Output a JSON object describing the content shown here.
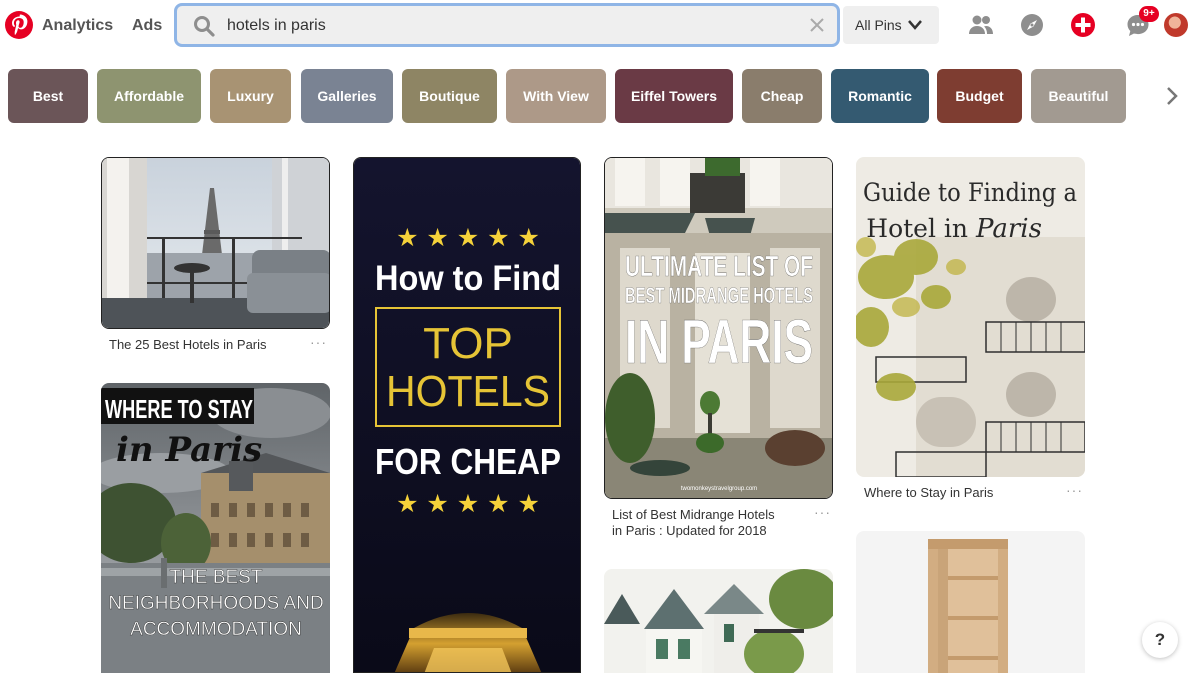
{
  "header": {
    "nav": {
      "analytics": "Analytics",
      "ads": "Ads"
    },
    "search": {
      "value": "hotels in paris",
      "placeholder": "Search"
    },
    "scope": {
      "label": "All Pins"
    },
    "notification_badge": "9+",
    "brand_color": "#e60023",
    "icons": [
      "pinterest-logo",
      "search-icon",
      "clear-icon",
      "chevron-down-icon",
      "people-icon",
      "compass-icon",
      "add-pin-icon",
      "messages-icon",
      "avatar"
    ]
  },
  "guides": [
    {
      "label": "Best",
      "color": "#6b5558"
    },
    {
      "label": "Affordable",
      "color": "#8e9470"
    },
    {
      "label": "Luxury",
      "color": "#a89373"
    },
    {
      "label": "Galleries",
      "color": "#7a8393"
    },
    {
      "label": "Boutique",
      "color": "#8e8564"
    },
    {
      "label": "With View",
      "color": "#ad9988"
    },
    {
      "label": "Eiffel Towers",
      "color": "#6a3a45"
    },
    {
      "label": "Cheap",
      "color": "#8a7d6c"
    },
    {
      "label": "Romantic",
      "color": "#345a71"
    },
    {
      "label": "Budget",
      "color": "#7e3d31"
    },
    {
      "label": "Beautiful",
      "color": "#a29a91"
    }
  ],
  "pins": {
    "p1": {
      "caption": "The 25 Best Hotels in Paris",
      "more": "···"
    },
    "p2": {
      "banner1": "WHERE TO STAY",
      "script": "in Paris",
      "lines": [
        "THE BEST",
        "NEIGHBORHOODS AND",
        "ACCOMMODATION"
      ]
    },
    "p3": {
      "stars": "★ ★ ★ ★ ★",
      "line1": "How to Find",
      "box1": "TOP",
      "box2": "HOTELS",
      "line2": "FOR CHEAP"
    },
    "p4": {
      "l1": "ULTIMATE LIST OF",
      "l2": "BEST MIDRANGE HOTELS",
      "l3": "IN PARIS",
      "source": "twomonkeystravelgroup.com",
      "caption_line1": "List of Best Midrange Hotels",
      "caption_line2": "in Paris : Updated for 2018",
      "more": "···"
    },
    "p6": {
      "title1": "Guide to Finding a",
      "title2": "Hotel in",
      "title_script": "Paris",
      "caption": "Where to Stay in Paris",
      "more": "···"
    }
  },
  "help": "?"
}
